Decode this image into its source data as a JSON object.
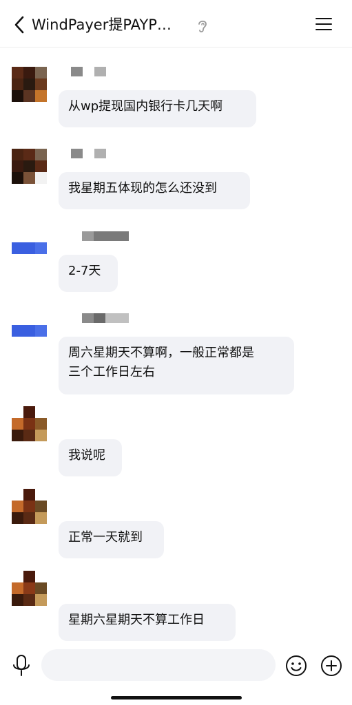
{
  "header": {
    "title": "WindPayer提PAYP…",
    "icons": {
      "back": "chevron-left-icon",
      "ear": "ear-icon",
      "menu": "hamburger-menu-icon"
    }
  },
  "messages": [
    {
      "text": "从wp提现国内银行卡几天啊"
    },
    {
      "text": "我星期五体现的怎么还没到"
    },
    {
      "text": "2-7天"
    },
    {
      "text": "周六星期天不算啊，一般正常都是\n三个工作日左右"
    },
    {
      "text": "我说呢"
    },
    {
      "text": "正常一天就到"
    },
    {
      "text": "星期六星期天不算工作日"
    }
  ],
  "input_bar": {
    "placeholder": "",
    "icons": {
      "mic": "microphone-icon",
      "emoji": "emoji-icon",
      "add": "add-circle-icon"
    }
  },
  "colors": {
    "bubble": "#f1f2f6",
    "blue_avatar": "#3a5fe0",
    "text": "#111111"
  }
}
